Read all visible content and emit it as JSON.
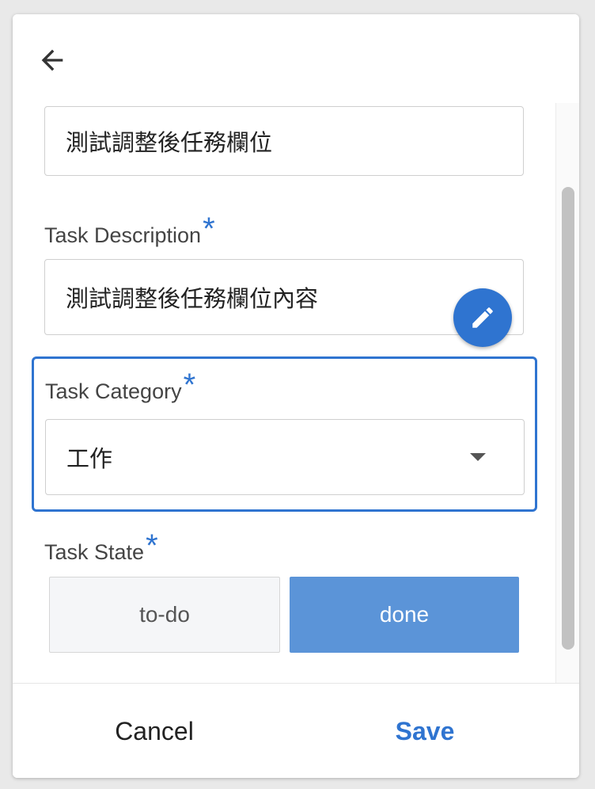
{
  "header": {
    "back_icon": "arrow-left-icon"
  },
  "form": {
    "title_value": "測試調整後任務欄位",
    "description": {
      "label": "Task Description",
      "required_mark": "*",
      "value": "測試調整後任務欄位內容",
      "edit_icon": "pencil-icon"
    },
    "category": {
      "label": "Task Category",
      "required_mark": "*",
      "selected": "工作",
      "dropdown_icon": "caret-down-icon"
    },
    "state": {
      "label": "Task State",
      "required_mark": "*",
      "options": [
        "to-do",
        "done"
      ],
      "selected": "done"
    }
  },
  "footer": {
    "cancel_label": "Cancel",
    "save_label": "Save"
  },
  "colors": {
    "accent": "#2f74d0",
    "selected_state": "#5b94d8"
  }
}
